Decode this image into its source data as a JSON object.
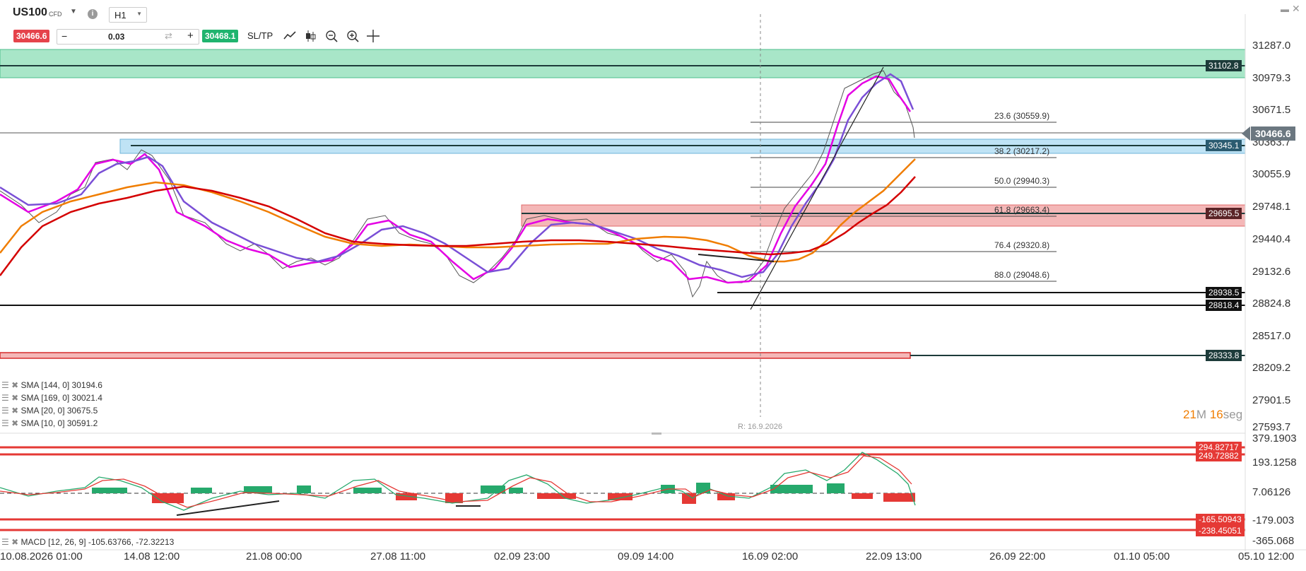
{
  "toolbar": {
    "symbol": "US100",
    "symbol_type": "CFD",
    "timeframe": "H1",
    "bid": "30466.6",
    "ask": "30468.1",
    "quantity": "0.03",
    "minus": "−",
    "plus": "+",
    "sltp": "SL/TP"
  },
  "price_axis": {
    "labels": [
      "31287.0",
      "30979.3",
      "30671.5",
      "30363.7",
      "30055.9",
      "29748.1",
      "29440.4",
      "29132.6",
      "28824.8",
      "28517.0",
      "28209.2",
      "27901.5",
      "27593.7"
    ]
  },
  "level_tags": {
    "upper_resistance": "31102.8",
    "current_price": "30466.6",
    "blue_zone": "30345.1",
    "red_zone": "29695.5",
    "support_1": "28938.5",
    "support_2": "28818.4",
    "low_zone": "28333.8"
  },
  "fibonacci": [
    "23.6 (30559.9)",
    "38.2 (30217.2)",
    "50.0 (29940.3)",
    "61.8 (29663.4)",
    "76.4 (29320.8)",
    "88.0 (29048.6)"
  ],
  "indicators": [
    "SMA [144, 0] 30194.6",
    "SMA [169, 0] 30021.4",
    "SMA [20, 0] 30675.5",
    "SMA [10, 0] 30591.2"
  ],
  "crosshair_label": "R: 16.9.2026",
  "countdown": {
    "minutes": "21",
    "m_unit": "M",
    "seconds": "16",
    "s_unit": "seg"
  },
  "macd": {
    "label": "MACD [12, 26, 9] -105.63766, -72.32213",
    "axis": [
      "379.1903",
      "193.1258",
      "7.06126",
      "-179.003",
      "-365.068"
    ],
    "tags": [
      "294.82717",
      "249.72882",
      "-165.50943",
      "-238.45051"
    ]
  },
  "time_axis": [
    "10.08.2026 01:00",
    "14.08 12:00",
    "21.08 00:00",
    "27.08 11:00",
    "02.09 23:00",
    "09.09 14:00",
    "16.09 02:00",
    "22.09 13:00",
    "26.09 22:00",
    "01.10 05:00",
    "05.10 12:00"
  ],
  "colors": {
    "green_zone": "#a8e6c8",
    "blue_zone": "#bfe3f5",
    "red_zone": "#f4b7b7",
    "sma144": "#f07d00",
    "sma169": "#d40000",
    "sma20": "#7a4fd6",
    "sma10": "#e400e4",
    "bid": "#e5434b",
    "ask": "#1fb46e"
  },
  "chart_data": {
    "type": "line",
    "title": "US100 H1",
    "ylim": [
      27593.7,
      31287.0
    ],
    "series": [
      {
        "name": "SMA [144, 0]",
        "last": 30194.6
      },
      {
        "name": "SMA [169, 0]",
        "last": 30021.4
      },
      {
        "name": "SMA [20, 0]",
        "last": 30675.5
      },
      {
        "name": "SMA [10, 0]",
        "last": 30591.2
      }
    ],
    "levels": [
      31102.8,
      30345.1,
      29695.5,
      28938.5,
      28818.4,
      28333.8
    ]
  }
}
